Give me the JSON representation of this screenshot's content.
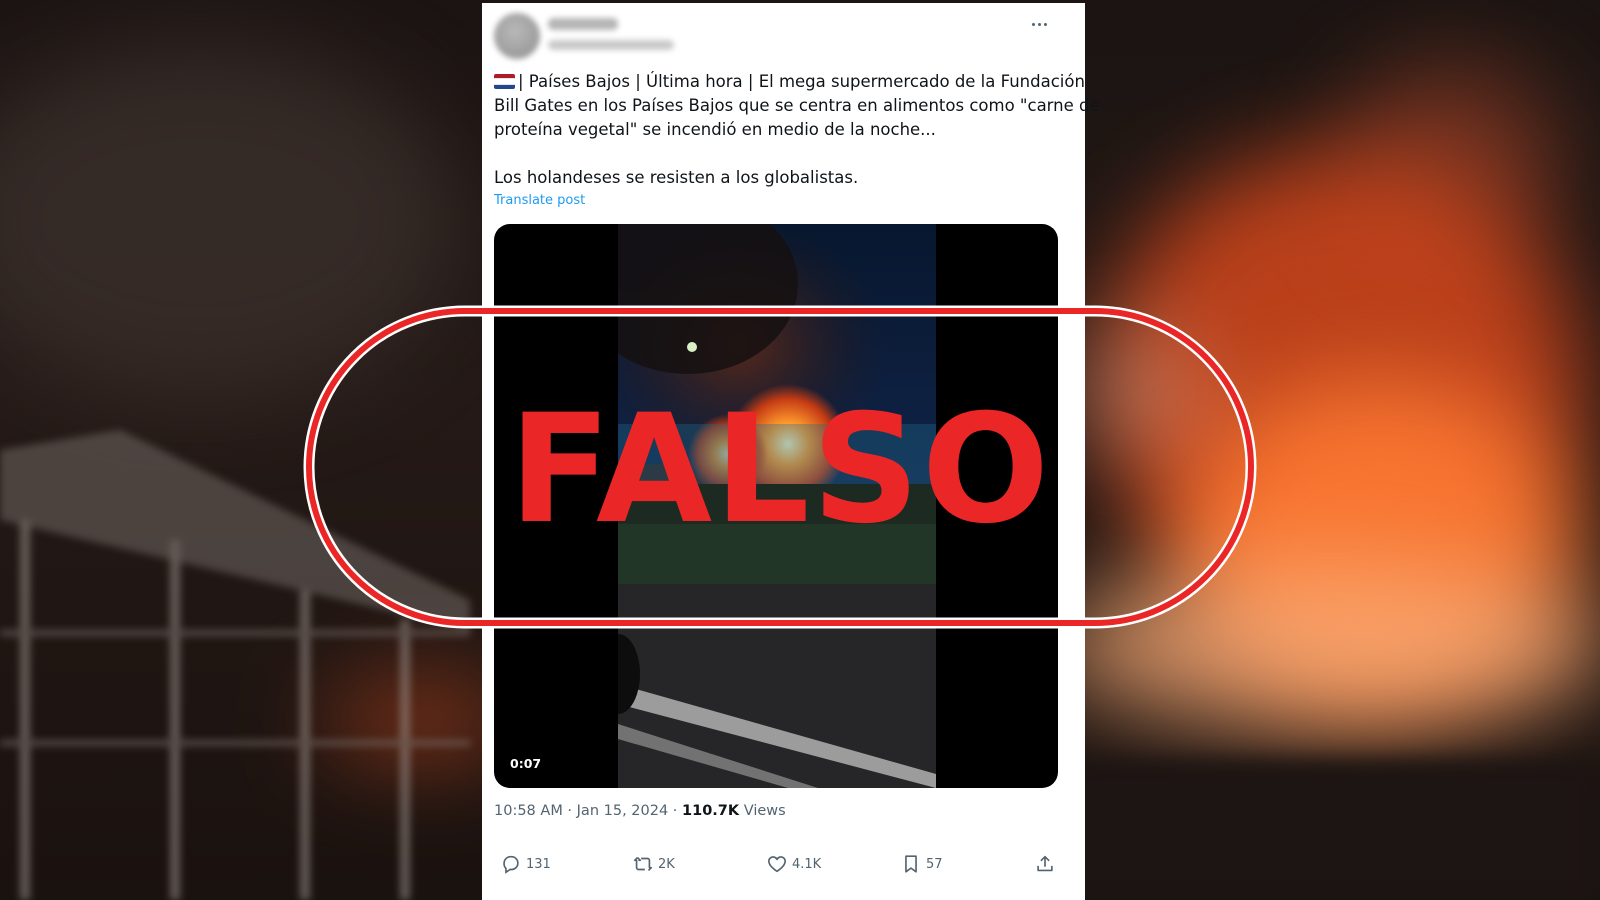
{
  "tweet": {
    "author_name": "",
    "author_handle": "",
    "flag": "netherlands-flag",
    "text_lines": [
      "| Países Bajos | Última hora | El mega supermercado de la Fundación",
      "Bill Gates en los Países Bajos que se centra en alimentos como \"carne de",
      "proteína vegetal\" se incendió en medio de la noche..."
    ],
    "text_line2": "Los holandeses se resisten a los globalistas.",
    "translate_label": "Translate post",
    "video": {
      "duration": "0:07"
    },
    "meta": {
      "time": "10:58 AM",
      "separator": " · ",
      "date": "Jan 15, 2024",
      "views_count": "110.7K",
      "views_label": "Views"
    },
    "actions": {
      "replies": "131",
      "reposts": "2K",
      "likes": "4.1K",
      "bookmarks": "57"
    }
  },
  "stamp": {
    "label": "FALSO",
    "color": "#ea2626"
  },
  "colors": {
    "accent": "#1d9bf0",
    "text": "#0f1419",
    "muted": "#536471",
    "stamp": "#ea2626"
  }
}
